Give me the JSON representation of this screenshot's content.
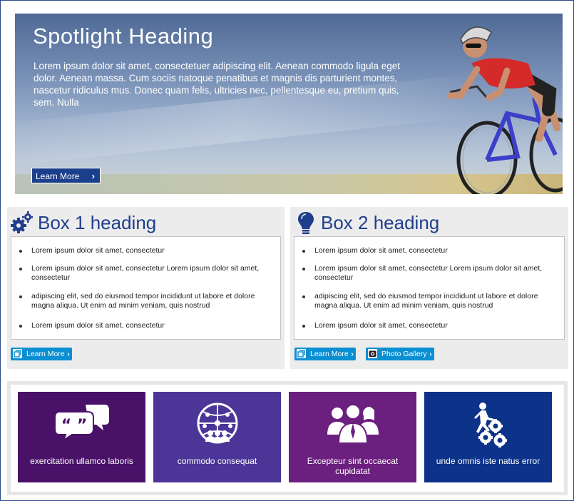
{
  "spotlight": {
    "title": "Spotlight Heading",
    "body": "Lorem ipsum dolor sit amet, consectetuer adipiscing elit. Aenean commodo ligula eget dolor. Aenean massa. Cum sociis natoque penatibus et magnis dis parturient montes, nascetur ridiculus mus. Donec quam felis, ultricies nec, pellentesque eu, pretium quis, sem. Nulla",
    "button_label": "Learn More"
  },
  "box1": {
    "icon": "gears-icon",
    "title": "Box 1 heading",
    "items": [
      "Lorem ipsum dolor sit amet, consectetur",
      "Lorem ipsum dolor sit amet, consectetur Lorem ipsum dolor sit amet, consectetur",
      "adipiscing elit, sed do eiusmod tempor incididunt ut labore et dolore magna aliqua. Ut enim ad minim veniam, quis nostrud",
      "Lorem ipsum dolor sit amet, consectetur"
    ],
    "button_label": "Learn More"
  },
  "box2": {
    "icon": "lightbulb-icon",
    "title": "Box 2 heading",
    "items": [
      "Lorem ipsum dolor sit amet, consectetur",
      "Lorem ipsum dolor sit amet, consectetur Lorem ipsum dolor sit amet, consectetur",
      "adipiscing elit, sed do eiusmod tempor incididunt ut labore et dolore magna aliqua. Ut enim ad minim veniam, quis nostrud",
      "Lorem ipsum dolor sit amet, consectetur"
    ],
    "learn_more_label": "Learn More",
    "gallery_label": "Photo Gallery"
  },
  "tiles": [
    {
      "label": "exercitation ullamco laboris",
      "icon": "speech-bubbles-icon",
      "color": "#4a1169"
    },
    {
      "label": "commodo consequat",
      "icon": "global-network-people-icon",
      "color": "#4b3596"
    },
    {
      "label": "Excepteur sint occaecat cupidatat",
      "icon": "team-people-icon",
      "color": "#6b1f7e"
    },
    {
      "label": "unde omnis iste natus error",
      "icon": "runner-gears-icon",
      "color": "#0c3289"
    }
  ],
  "colors": {
    "heading_blue": "#1f3e8c",
    "button_blue": "#0a8fd2",
    "hero_button": "#1c3f8c"
  }
}
